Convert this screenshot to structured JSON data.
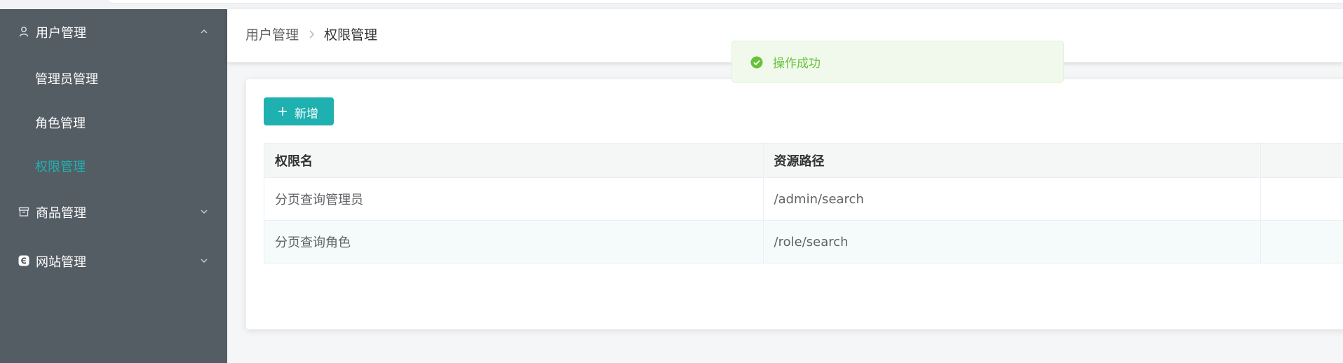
{
  "sidebar": {
    "groups": [
      {
        "label": "用户管理",
        "icon": "user-icon",
        "expanded": true,
        "items": [
          {
            "label": "管理员管理",
            "active": false
          },
          {
            "label": "角色管理",
            "active": false
          },
          {
            "label": "权限管理",
            "active": true
          }
        ]
      },
      {
        "label": "商品管理",
        "icon": "box-icon",
        "expanded": false
      },
      {
        "label": "网站管理",
        "icon": "site-icon",
        "expanded": false
      }
    ]
  },
  "breadcrumb": {
    "parent": "用户管理",
    "current": "权限管理"
  },
  "toast": {
    "message": "操作成功",
    "type": "success"
  },
  "toolbar": {
    "add_label": "新增"
  },
  "table": {
    "columns": [
      "权限名",
      "资源路径",
      ""
    ],
    "rows": [
      [
        "分页查询管理员",
        "/admin/search",
        ""
      ],
      [
        "分页查询角色",
        "/role/search",
        ""
      ]
    ]
  },
  "colors": {
    "accent": "#1fb0b0",
    "sidebar_bg": "#545c64",
    "success": "#67c23a"
  }
}
